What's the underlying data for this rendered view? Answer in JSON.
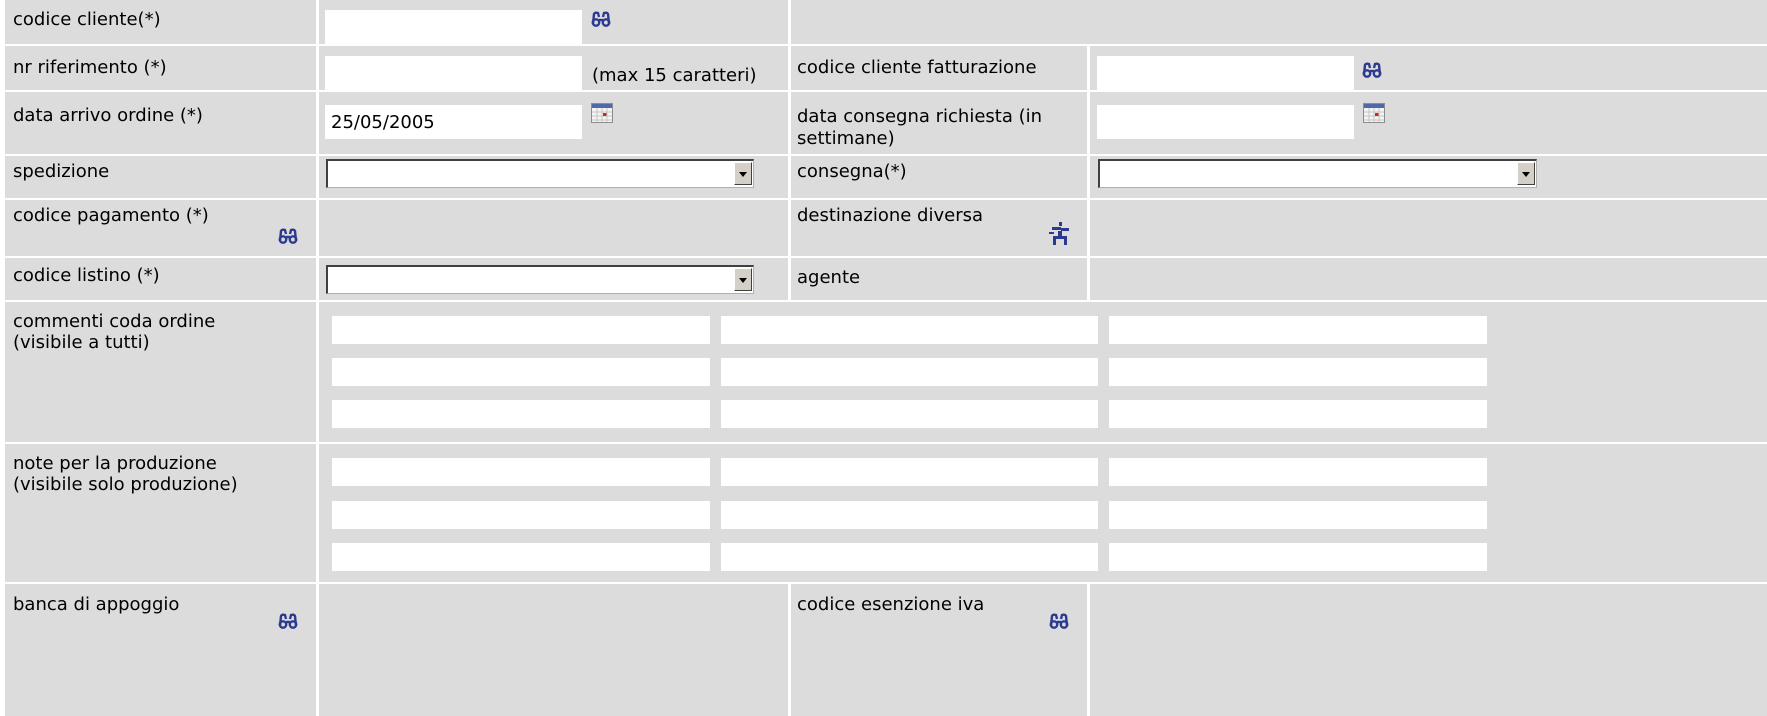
{
  "form": {
    "codice_cliente": {
      "label": "codice cliente(*)",
      "value": "",
      "icon": "lookup-binoculars-icon"
    },
    "nr_riferimento": {
      "label": "nr riferimento (*)",
      "value": "",
      "hint": "(max 15 caratteri)"
    },
    "codice_cliente_fatturazione": {
      "label": "codice cliente fatturazione",
      "value": "",
      "icon": "lookup-binoculars-icon"
    },
    "data_arrivo_ordine": {
      "label": "data arrivo ordine (*)",
      "value": "25/05/2005",
      "icon": "calendar-icon"
    },
    "data_consegna_richiesta": {
      "label_line1": "data consegna richiesta (in",
      "label_line2": "settimane)",
      "value": "",
      "icon": "calendar-icon"
    },
    "spedizione": {
      "label": "spedizione",
      "selected": ""
    },
    "consegna": {
      "label": "consegna(*)",
      "selected": ""
    },
    "codice_pagamento": {
      "label": "codice pagamento (*)",
      "icon": "lookup-binoculars-icon"
    },
    "destinazione_diversa": {
      "label": "destinazione diversa",
      "icon": "destination-icon"
    },
    "codice_listino": {
      "label": "codice listino (*)",
      "selected": ""
    },
    "agente": {
      "label": "agente"
    },
    "commenti_coda_ordine": {
      "label_line1": "commenti coda ordine",
      "label_line2": "(visibile a tutti)"
    },
    "note_produzione": {
      "label_line1": "note per la produzione",
      "label_line2": "(visibile solo produzione)"
    },
    "banca_di_appoggio": {
      "label": "banca di appoggio",
      "icon": "lookup-binoculars-icon"
    },
    "codice_esenzione_iva": {
      "label": "codice esenzione iva",
      "icon": "lookup-binoculars-icon"
    }
  },
  "colors": {
    "cell_bg": "#dcdcdc",
    "grid_line": "#ffffff",
    "icon": "#2b3a8f"
  }
}
